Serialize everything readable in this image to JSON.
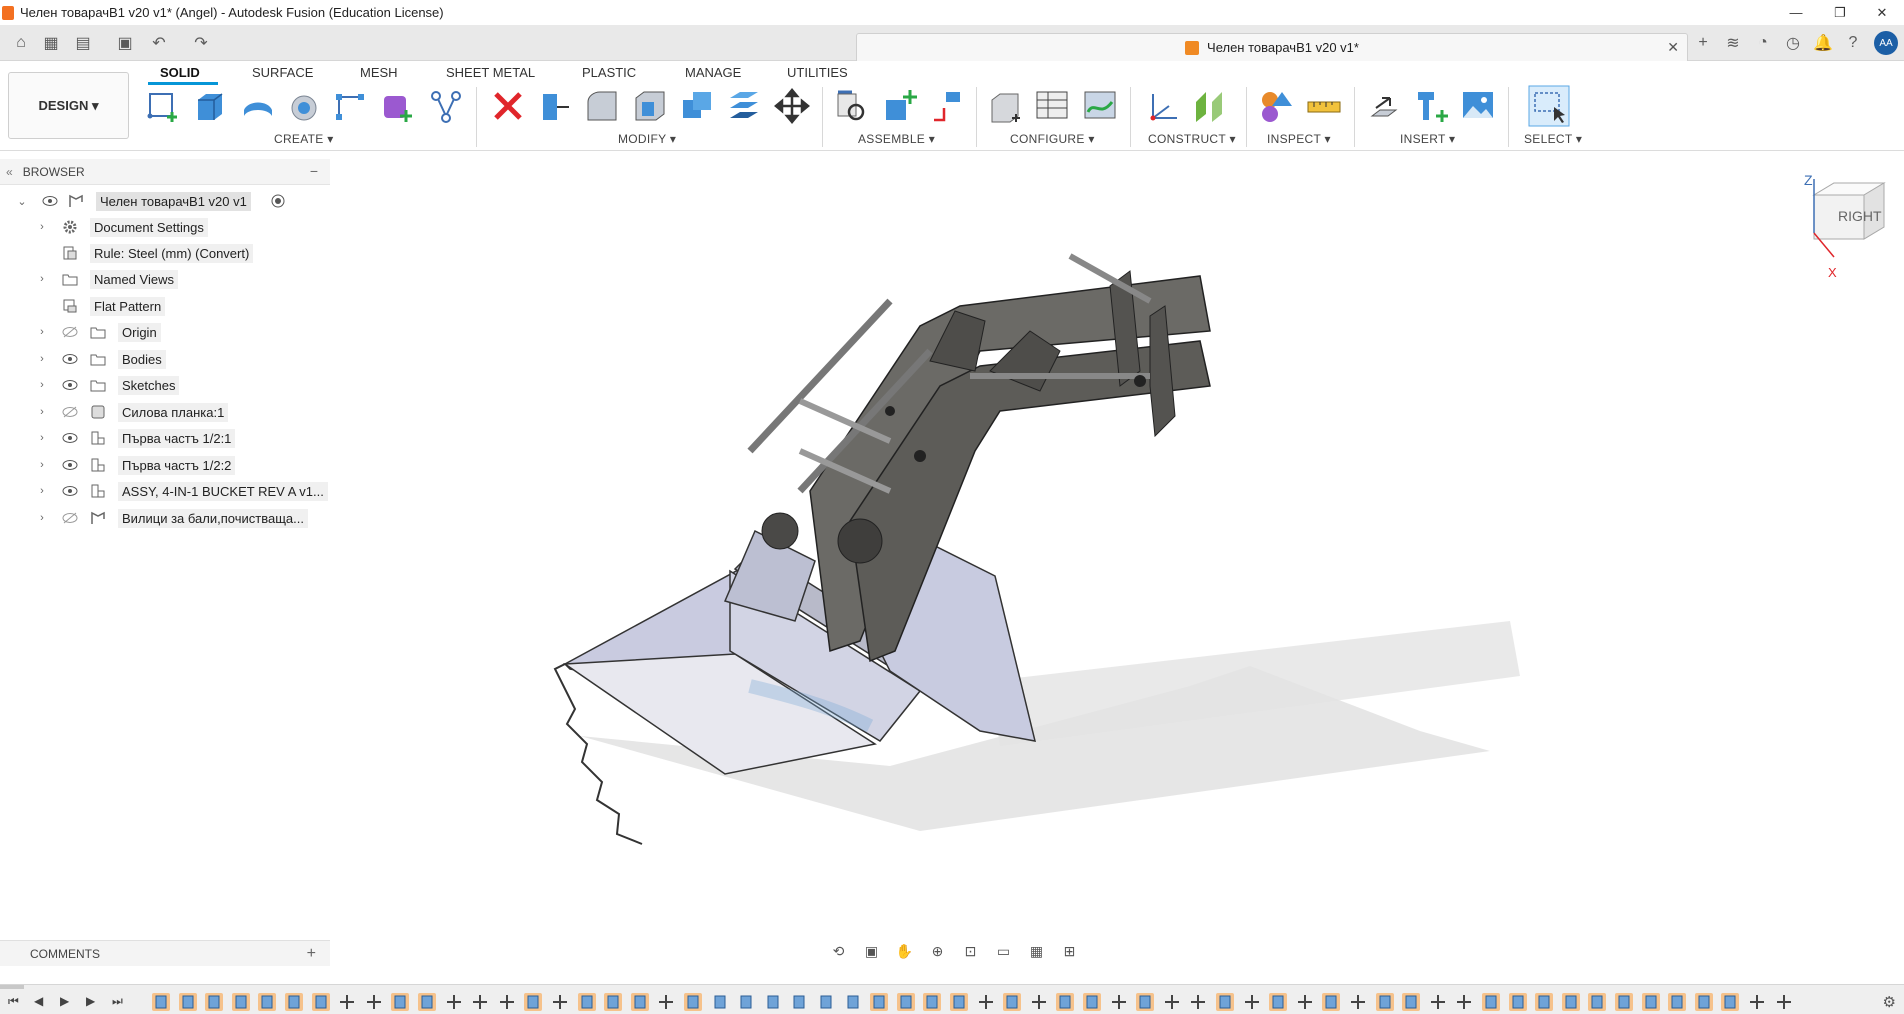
{
  "window": {
    "title": "Челен товарачВ1 v20 v1* (Angel) - Autodesk Fusion (Education License)",
    "controls": [
      "—",
      "❐",
      "✕"
    ]
  },
  "document_tab": {
    "title": "Челен товарачВ1 v20 v1*"
  },
  "user": {
    "initials": "AA"
  },
  "ribbon": {
    "workspace_button": "DESIGN ▾",
    "tabs": [
      "SOLID",
      "SURFACE",
      "MESH",
      "SHEET METAL",
      "PLASTIC",
      "MANAGE",
      "UTILITIES"
    ],
    "active_tab": "SOLID",
    "groups": [
      "CREATE ▾",
      "MODIFY ▾",
      "ASSEMBLE ▾",
      "CONFIGURE ▾",
      "CONSTRUCT ▾",
      "INSPECT ▾",
      "INSERT ▾",
      "SELECT ▾"
    ]
  },
  "browser": {
    "header": "BROWSER",
    "root": "Челен товарачВ1 v20 v1",
    "items": [
      {
        "label": "Document Settings",
        "icon": "gear-icon"
      },
      {
        "label": "Rule: Steel (mm) (Convert)",
        "icon": "rule-icon"
      },
      {
        "label": "Named Views",
        "icon": "folder-icon"
      },
      {
        "label": "Flat Pattern",
        "icon": "flat-pattern-icon"
      },
      {
        "label": "Origin",
        "icon": "folder-icon"
      },
      {
        "label": "Bodies",
        "icon": "folder-icon"
      },
      {
        "label": "Sketches",
        "icon": "folder-icon"
      },
      {
        "label": "Силова планка:1",
        "icon": "body-icon"
      },
      {
        "label": "Първа частъ 1/2:1",
        "icon": "component-icon"
      },
      {
        "label": "Първа частъ 1/2:2",
        "icon": "component-icon"
      },
      {
        "label": "ASSY, 4-IN-1 BUCKET REV A v1...",
        "icon": "component-icon"
      },
      {
        "label": "Вилици за бали,почистваща...",
        "icon": "component-icon"
      }
    ]
  },
  "viewcube": {
    "face": "RIGHT",
    "axis_z": "Z",
    "axis_x": "X"
  },
  "comments": {
    "label": "COMMENTS"
  },
  "colors": {
    "accent": "#0696d7",
    "brand_orange": "#f37021",
    "timeline_feature": "#6fa3d8",
    "timeline_highlight": "#f6c28b"
  }
}
